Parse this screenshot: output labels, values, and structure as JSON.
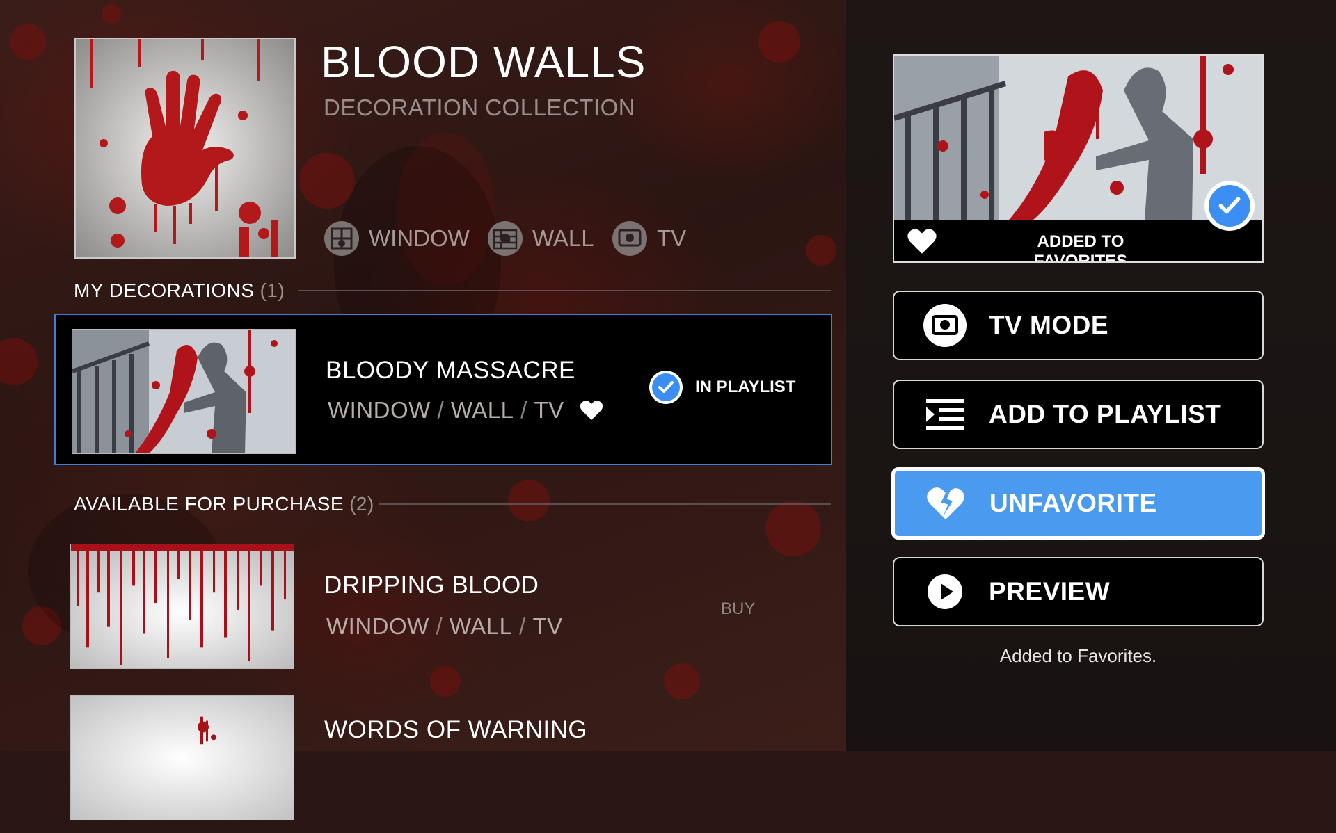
{
  "collection": {
    "title": "BLOOD WALLS",
    "subtitle": "DECORATION COLLECTION",
    "modes": [
      {
        "label": "WINDOW",
        "icon": "window-icon"
      },
      {
        "label": "WALL",
        "icon": "wall-icon"
      },
      {
        "label": "TV",
        "icon": "tv-icon"
      }
    ]
  },
  "my_decorations": {
    "heading": "MY DECORATIONS",
    "count": "(1)",
    "items": [
      {
        "name": "BLOODY MASSACRE",
        "modes": [
          "WINDOW",
          "WALL",
          "TV"
        ],
        "favorite": true,
        "status": "IN PLAYLIST"
      }
    ]
  },
  "available": {
    "heading": "AVAILABLE FOR PURCHASE",
    "count": "(2)",
    "items": [
      {
        "name": "DRIPPING BLOOD",
        "modes": [
          "WINDOW",
          "WALL",
          "TV"
        ],
        "action": "BUY"
      },
      {
        "name": "WORDS OF WARNING"
      }
    ]
  },
  "side_panel": {
    "favorite_banner": "ADDED TO FAVORITES",
    "buttons": [
      {
        "label": "TV MODE",
        "icon": "tv-icon",
        "active": false
      },
      {
        "label": "ADD TO PLAYLIST",
        "icon": "playlist-icon",
        "active": false
      },
      {
        "label": "UNFAVORITE",
        "icon": "broken-heart-icon",
        "active": true
      },
      {
        "label": "PREVIEW",
        "icon": "play-icon",
        "active": false
      }
    ],
    "status_message": "Added to Favorites."
  },
  "colors": {
    "accent": "#4a9af0",
    "check_blue": "#3b8ff3",
    "selection_border": "#3f7fd6",
    "blood_red": "#9b1010"
  }
}
